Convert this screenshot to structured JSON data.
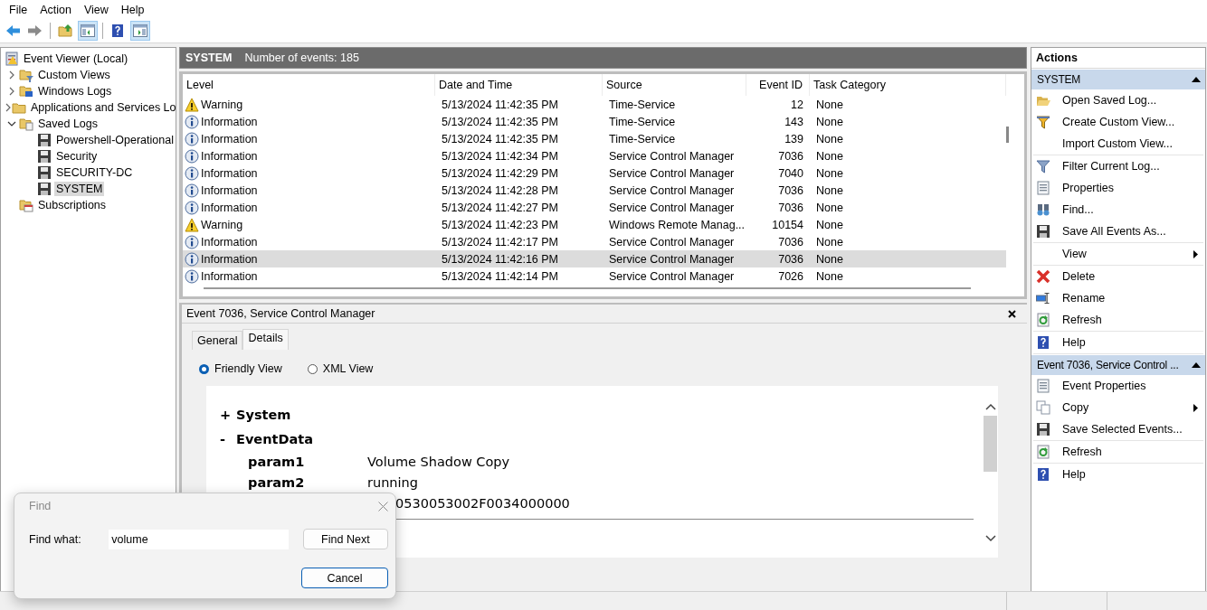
{
  "menu_bar": [
    "File",
    "Action",
    "View",
    "Help"
  ],
  "toolbar": [
    {
      "kind": "back",
      "pressed": false
    },
    {
      "kind": "forward",
      "pressed": false
    },
    {
      "kind": "sep"
    },
    {
      "kind": "up",
      "pressed": false
    },
    {
      "kind": "tree-pane",
      "pressed": true
    },
    {
      "kind": "sep"
    },
    {
      "kind": "help",
      "pressed": false
    },
    {
      "kind": "action-pane",
      "pressed": true
    }
  ],
  "tree": {
    "label": "Event Viewer (Local)",
    "kind": "root",
    "selected": false,
    "children": [
      {
        "label": "Custom Views",
        "kind": "custom-views",
        "expanded": false,
        "selected": false
      },
      {
        "label": "Windows Logs",
        "kind": "windows-logs",
        "expanded": false,
        "selected": false
      },
      {
        "label": "Applications and Services Lo",
        "kind": "folder",
        "expanded": false,
        "selected": false
      },
      {
        "label": "Saved Logs",
        "kind": "saved",
        "expanded": true,
        "selected": false,
        "children": [
          {
            "label": "Powershell-Operational",
            "kind": "log",
            "selected": false
          },
          {
            "label": "Security",
            "kind": "log",
            "selected": false
          },
          {
            "label": "SECURITY-DC",
            "kind": "log",
            "selected": false
          },
          {
            "label": "SYSTEM",
            "kind": "log",
            "selected": true
          }
        ]
      },
      {
        "label": "Subscriptions",
        "kind": "subscriptions",
        "selected": false
      }
    ]
  },
  "log_header": {
    "title": "SYSTEM",
    "count": "Number of events: 185"
  },
  "events": {
    "columns": [
      "Level",
      "Date and Time",
      "Source",
      "Event ID",
      "Task Category"
    ],
    "rows": [
      {
        "kind": "warning",
        "level_name": "Warning",
        "date": "5/13/2024 11:42:35 PM",
        "source": "Time-Service",
        "event_id": "12",
        "task_category": "None",
        "selected": false
      },
      {
        "kind": "info",
        "level_name": "Information",
        "date": "5/13/2024 11:42:35 PM",
        "source": "Time-Service",
        "event_id": "143",
        "task_category": "None",
        "selected": false
      },
      {
        "kind": "info",
        "level_name": "Information",
        "date": "5/13/2024 11:42:35 PM",
        "source": "Time-Service",
        "event_id": "139",
        "task_category": "None",
        "selected": false
      },
      {
        "kind": "info",
        "level_name": "Information",
        "date": "5/13/2024 11:42:34 PM",
        "source": "Service Control Manager",
        "event_id": "7036",
        "task_category": "None",
        "selected": false
      },
      {
        "kind": "info",
        "level_name": "Information",
        "date": "5/13/2024 11:42:29 PM",
        "source": "Service Control Manager",
        "event_id": "7040",
        "task_category": "None",
        "selected": false
      },
      {
        "kind": "info",
        "level_name": "Information",
        "date": "5/13/2024 11:42:28 PM",
        "source": "Service Control Manager",
        "event_id": "7036",
        "task_category": "None",
        "selected": false
      },
      {
        "kind": "info",
        "level_name": "Information",
        "date": "5/13/2024 11:42:27 PM",
        "source": "Service Control Manager",
        "event_id": "7036",
        "task_category": "None",
        "selected": false
      },
      {
        "kind": "warning",
        "level_name": "Warning",
        "date": "5/13/2024 11:42:23 PM",
        "source": "Windows Remote Manag...",
        "event_id": "10154",
        "task_category": "None",
        "selected": false
      },
      {
        "kind": "info",
        "level_name": "Information",
        "date": "5/13/2024 11:42:17 PM",
        "source": "Service Control Manager",
        "event_id": "7036",
        "task_category": "None",
        "selected": false
      },
      {
        "kind": "info",
        "level_name": "Information",
        "date": "5/13/2024 11:42:16 PM",
        "source": "Service Control Manager",
        "event_id": "7036",
        "task_category": "None",
        "selected": true
      },
      {
        "kind": "info",
        "level_name": "Information",
        "date": "5/13/2024 11:42:14 PM",
        "source": "Service Control Manager",
        "event_id": "7026",
        "task_category": "None",
        "selected": false
      }
    ]
  },
  "event_detail": {
    "title": "Event 7036, Service Control Manager",
    "tabs": [
      {
        "label": "General",
        "selected": false
      },
      {
        "label": "Details",
        "selected": true
      }
    ],
    "views": [
      {
        "label": "Friendly View",
        "selected": true
      },
      {
        "label": "XML View",
        "selected": false
      }
    ],
    "sections": [
      {
        "toggle": "+",
        "label": "System"
      },
      {
        "toggle": "-",
        "label": "EventData",
        "fields": [
          {
            "name": "param1",
            "value": "Volume Shadow Copy"
          },
          {
            "name": "param2",
            "value": "running"
          },
          {
            "value": "0530053002F0034000000"
          }
        ]
      }
    ]
  },
  "actions": {
    "title": "Actions",
    "groups": [
      {
        "title": "SYSTEM",
        "expanded": true,
        "blocks": [
          [
            {
              "label": "Open Saved Log...",
              "kind": "open",
              "submenu": false
            },
            {
              "label": "Create Custom View...",
              "kind": "funnel",
              "submenu": false
            },
            {
              "label": "Import Custom View...",
              "kind": "none",
              "submenu": false
            }
          ],
          [
            {
              "label": "Filter Current Log...",
              "kind": "filter",
              "submenu": false
            },
            {
              "label": "Properties",
              "kind": "properties",
              "submenu": false
            },
            {
              "label": "Find...",
              "kind": "find",
              "submenu": false
            },
            {
              "label": "Save All Events As...",
              "kind": "save",
              "submenu": false
            }
          ],
          [
            {
              "label": "View",
              "kind": "none",
              "submenu": true
            }
          ],
          [
            {
              "label": "Delete",
              "kind": "delete",
              "submenu": false
            },
            {
              "label": "Rename",
              "kind": "rename",
              "submenu": false
            },
            {
              "label": "Refresh",
              "kind": "refresh",
              "submenu": false
            }
          ],
          [
            {
              "label": "Help",
              "kind": "help",
              "submenu": false
            }
          ]
        ]
      },
      {
        "title": "Event 7036, Service Control ...",
        "expanded": true,
        "blocks": [
          [
            {
              "label": "Event Properties",
              "kind": "properties",
              "submenu": false
            },
            {
              "label": "Copy",
              "kind": "copy",
              "submenu": true
            },
            {
              "label": "Save Selected Events...",
              "kind": "save",
              "submenu": false
            }
          ],
          [
            {
              "label": "Refresh",
              "kind": "refresh",
              "submenu": false
            }
          ],
          [
            {
              "label": "Help",
              "kind": "help",
              "submenu": false
            }
          ]
        ]
      }
    ]
  },
  "find_dialog": {
    "title": "Find",
    "label": "Find what:",
    "value": "volume",
    "buttons": [
      {
        "label": "Find Next",
        "default": false
      },
      {
        "label": "Cancel",
        "default": true
      }
    ]
  }
}
